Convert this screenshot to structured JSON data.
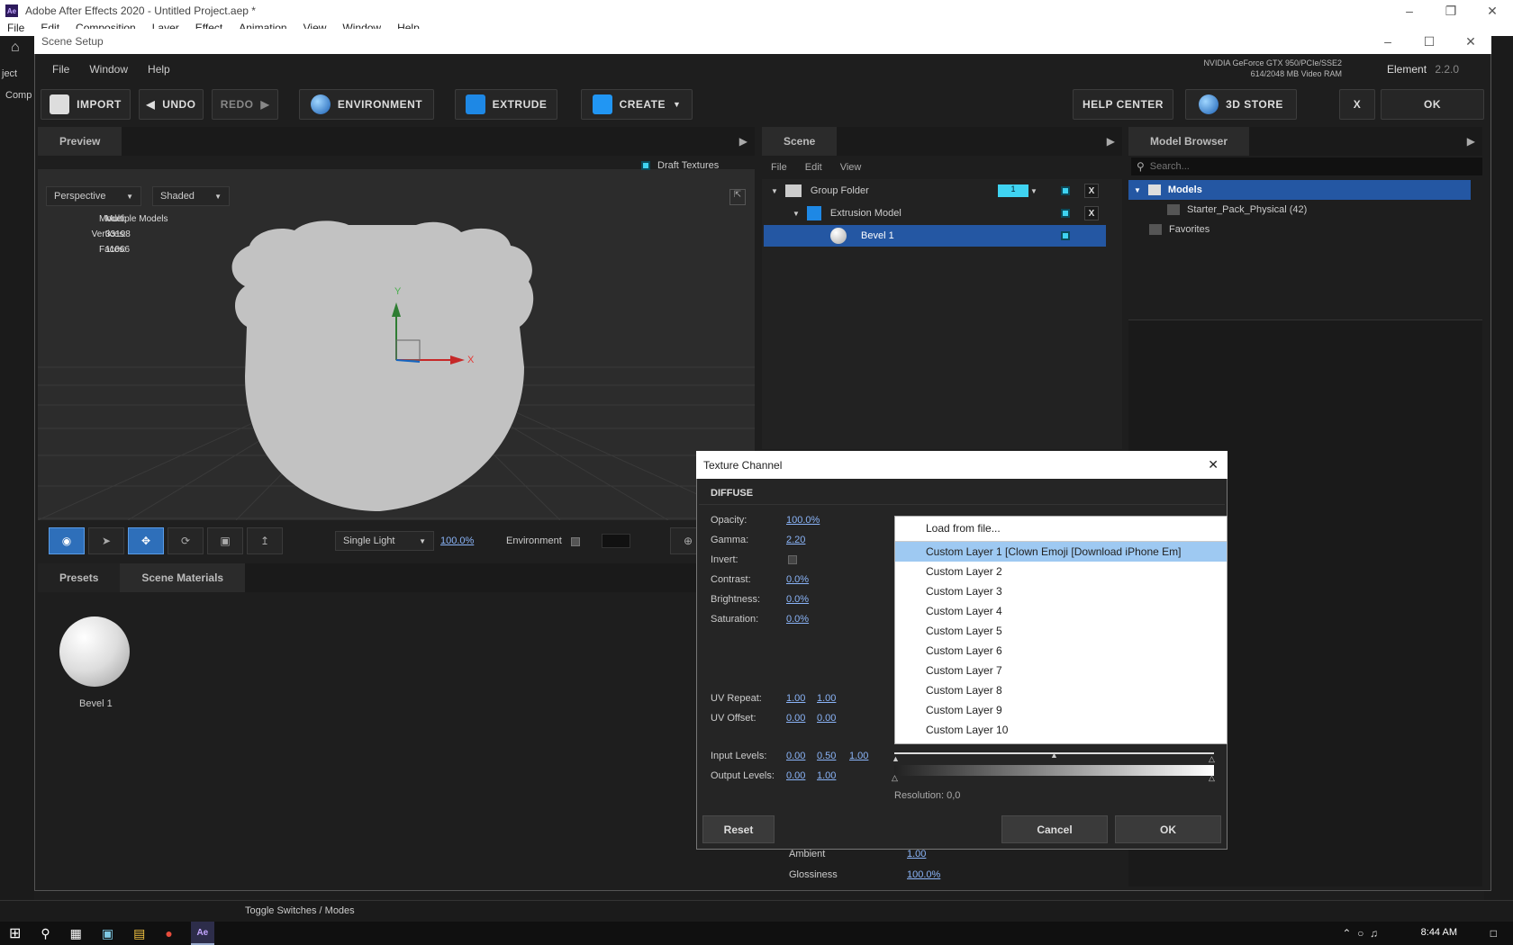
{
  "app": {
    "title": "Adobe After Effects 2020 - Untitled Project.aep *",
    "logo": "Ae",
    "menu": [
      "File",
      "Edit",
      "Composition",
      "Layer",
      "Effect",
      "Animation",
      "View",
      "Window",
      "Help"
    ],
    "left_labels": [
      "ject",
      "Comp"
    ],
    "bottom_status": "Toggle Switches / Modes"
  },
  "scene_setup": {
    "title": "Scene Setup",
    "menu": [
      "File",
      "Window",
      "Help"
    ],
    "gpu_line1": "NVIDIA GeForce GTX 950/PCIe/SSE2",
    "gpu_line2": "614/2048 MB Video RAM",
    "element_label": "Element",
    "element_version": "2.2.0",
    "toolbar": {
      "import": "IMPORT",
      "undo": "UNDO",
      "redo": "REDO",
      "environment": "ENVIRONMENT",
      "extrude": "EXTRUDE",
      "create": "CREATE",
      "help_center": "HELP CENTER",
      "store": "3D STORE",
      "close": "X",
      "ok": "OK"
    }
  },
  "preview": {
    "tab": "Preview",
    "draft_textures": "Draft Textures",
    "camera_mode": "Perspective",
    "render_mode": "Shaded",
    "model_label": "Model:",
    "model_value": "Multiple Models",
    "vertices_label": "Vertices:",
    "vertices_value": "33198",
    "faces_label": "Faces:",
    "faces_value": "11066",
    "axis_y": "Y",
    "axis_x": "X",
    "light_mode": "Single Light",
    "light_pct": "100.0%",
    "environment_label": "Environment"
  },
  "presets": {
    "tabs": [
      "Presets",
      "Scene Materials"
    ],
    "material_name": "Bevel 1"
  },
  "scene": {
    "tab": "Scene",
    "menu": [
      "File",
      "Edit",
      "View"
    ],
    "rows": [
      {
        "label": "Group Folder",
        "count": "1"
      },
      {
        "label": "Extrusion Model"
      },
      {
        "label": "Bevel 1"
      }
    ],
    "x_label": "X",
    "ambient_label": "Ambient",
    "ambient_value": "1.00",
    "gloss_label": "Glossiness",
    "gloss_value": "100.0%"
  },
  "model_browser": {
    "tab": "Model Browser",
    "search_placeholder": "Search...",
    "models": "Models",
    "starter": "Starter_Pack_Physical (42)",
    "favorites": "Favorites"
  },
  "texture_channel": {
    "title": "Texture Channel",
    "section": "DIFFUSE",
    "opacity_label": "Opacity:",
    "opacity": "100.0%",
    "gamma_label": "Gamma:",
    "gamma": "2.20",
    "invert_label": "Invert:",
    "contrast_label": "Contrast:",
    "contrast": "0.0%",
    "brightness_label": "Brightness:",
    "brightness": "0.0%",
    "saturation_label": "Saturation:",
    "saturation": "0.0%",
    "uv_repeat_label": "UV Repeat:",
    "uv_repeat_u": "1.00",
    "uv_repeat_v": "1.00",
    "uv_offset_label": "UV Offset:",
    "uv_offset_u": "0.00",
    "uv_offset_v": "0.00",
    "input_levels_label": "Input Levels:",
    "in_low": "0.00",
    "in_mid": "0.50",
    "in_high": "1.00",
    "output_levels_label": "Output Levels:",
    "out_low": "0.00",
    "out_high": "1.00",
    "resolution": "Resolution: 0,0",
    "reset": "Reset",
    "cancel": "Cancel",
    "ok": "OK",
    "dropdown": [
      "Load from file...",
      "Custom Layer 1 [Clown Emoji [Download iPhone Em]",
      "Custom Layer 2",
      "Custom Layer 3",
      "Custom Layer 4",
      "Custom Layer 5",
      "Custom Layer 6",
      "Custom Layer 7",
      "Custom Layer 8",
      "Custom Layer 9",
      "Custom Layer 10"
    ]
  },
  "taskbar": {
    "time": "8:44 AM"
  }
}
